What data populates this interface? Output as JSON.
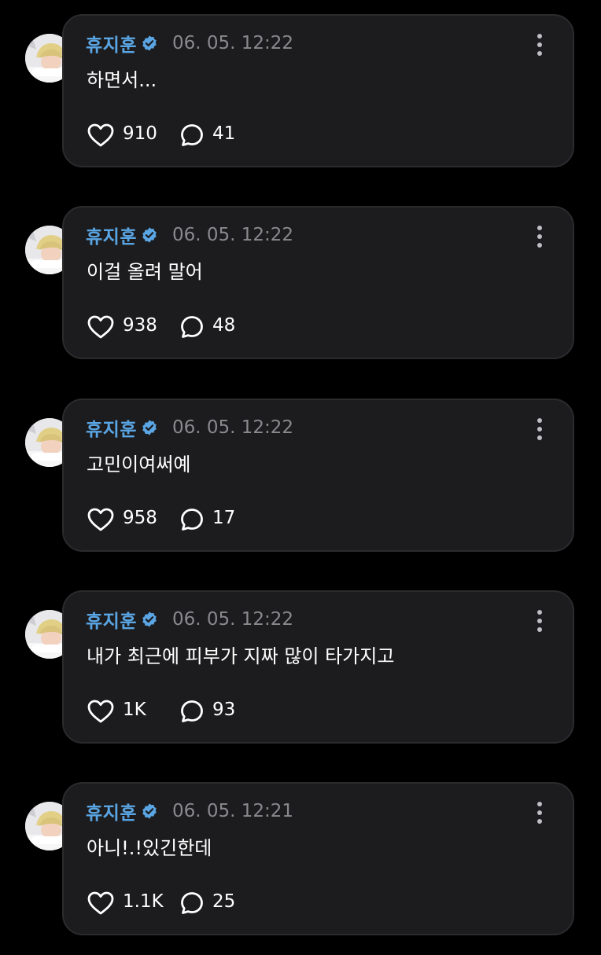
{
  "posts": [
    {
      "author": "휴지훈",
      "time": "06. 05. 12:22",
      "text": "하면서...",
      "likes": "910",
      "replies": "41"
    },
    {
      "author": "휴지훈",
      "time": "06. 05. 12:22",
      "text": "이걸 올려 말어",
      "likes": "938",
      "replies": "48"
    },
    {
      "author": "휴지훈",
      "time": "06. 05. 12:22",
      "text": "고민이여써예",
      "likes": "958",
      "replies": "17"
    },
    {
      "author": "휴지훈",
      "time": "06. 05. 12:22",
      "text": "내가 최근에 피부가 지짜 많이 타가지고",
      "likes": "1K",
      "replies": "93"
    },
    {
      "author": "휴지훈",
      "time": "06. 05. 12:21",
      "text": "아니!.!있긴한데",
      "likes": "1.1K",
      "replies": "25"
    }
  ],
  "colors": {
    "background": "#000000",
    "bubble": "#1c1c1e",
    "name": "#5aa5e3",
    "verified": "#5aa5e3",
    "timestamp": "#8a8a8e"
  },
  "icons": {
    "verified": "verified-badge-icon",
    "like": "heart-icon",
    "reply": "speech-bubble-icon",
    "more": "more-vertical-icon"
  }
}
